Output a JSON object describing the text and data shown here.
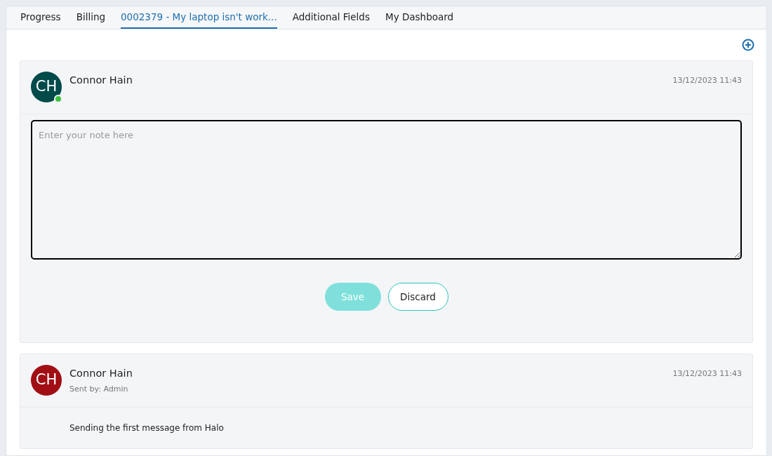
{
  "tabs": [
    {
      "label": "Progress",
      "selected": false
    },
    {
      "label": "Billing",
      "selected": false
    },
    {
      "label": "0002379 - My laptop isn't work...",
      "selected": true
    },
    {
      "label": "Additional Fields",
      "selected": false
    },
    {
      "label": "My Dashboard",
      "selected": false
    }
  ],
  "editor": {
    "initials": "CH",
    "color": "#004a4a",
    "online": true,
    "name": "Connor Hain",
    "time": "13/12/2023 11:43",
    "placeholder": "Enter your note here",
    "save": {
      "label": "Save",
      "disabled": true
    },
    "discard": {
      "label": "Discard"
    }
  },
  "notes": [
    {
      "initials": "CH",
      "color": "#a10e14",
      "online": false,
      "name": "Connor Hain",
      "sent_by": "Sent by: Admin",
      "time": "13/12/2023 11:43",
      "body": "Sending the first message from Halo"
    }
  ]
}
